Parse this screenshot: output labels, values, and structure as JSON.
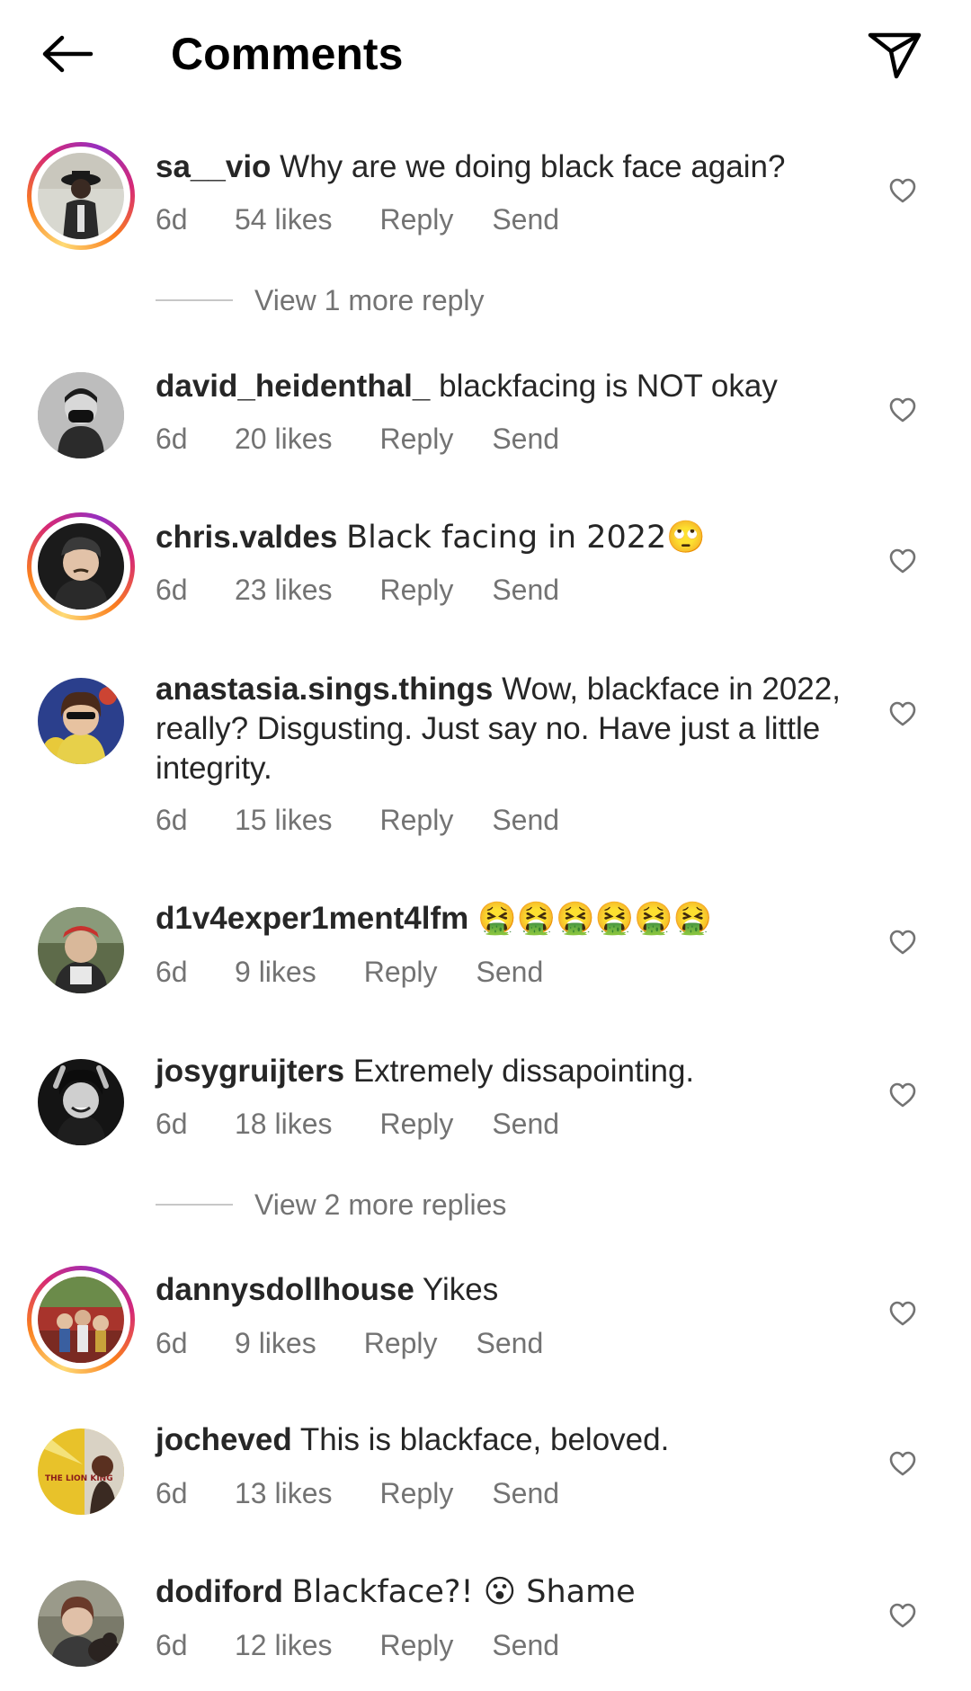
{
  "header": {
    "title": "Comments",
    "back_icon": "arrow-left-icon",
    "share_icon": "paper-plane-icon"
  },
  "comments": [
    {
      "username": "sa__vio",
      "text": "Why are we doing black face again?",
      "time": "6d",
      "likes": "54 likes",
      "reply": "Reply",
      "send": "Send",
      "story_ring": true
    },
    {
      "username": "david_heidenthal_",
      "text": "blackfacing is NOT okay",
      "time": "6d",
      "likes": "20 likes",
      "reply": "Reply",
      "send": "Send",
      "story_ring": false
    },
    {
      "username": "chris.valdes",
      "text": "Black facing in 2022🙄",
      "time": "6d",
      "likes": "23 likes",
      "reply": "Reply",
      "send": "Send",
      "story_ring": true
    },
    {
      "username": "anastasia.sings.things",
      "text": "Wow, blackface in 2022, really? Disgusting. Just say no. Have just a little integrity.",
      "time": "6d",
      "likes": "15 likes",
      "reply": "Reply",
      "send": "Send",
      "story_ring": false
    },
    {
      "username": "d1v4exper1ment4lfm",
      "text": "🤮🤮🤮🤮🤮🤮",
      "time": "6d",
      "likes": "9 likes",
      "reply": "Reply",
      "send": "Send",
      "story_ring": false
    },
    {
      "username": "josygruijters",
      "text": "Extremely dissapointing.",
      "time": "6d",
      "likes": "18 likes",
      "reply": "Reply",
      "send": "Send",
      "story_ring": false
    },
    {
      "username": "dannysdollhouse",
      "text": "Yikes",
      "time": "6d",
      "likes": "9 likes",
      "reply": "Reply",
      "send": "Send",
      "story_ring": true
    },
    {
      "username": "jocheved",
      "text": "This is blackface, beloved.",
      "time": "6d",
      "likes": "13 likes",
      "reply": "Reply",
      "send": "Send",
      "story_ring": false
    },
    {
      "username": "dodiford",
      "text": "Blackface?! 😮 Shame",
      "time": "6d",
      "likes": "12 likes",
      "reply": "Reply",
      "send": "Send",
      "story_ring": false
    }
  ],
  "view_replies": [
    {
      "label": "View 1 more reply"
    },
    {
      "label": "View 2 more replies"
    }
  ],
  "avatar_badges": {
    "jocheved": "THE LION KING"
  },
  "colors": {
    "text": "#262626",
    "meta": "#737373",
    "divider": "#c7c7c7",
    "story_ring": "#d62976"
  }
}
